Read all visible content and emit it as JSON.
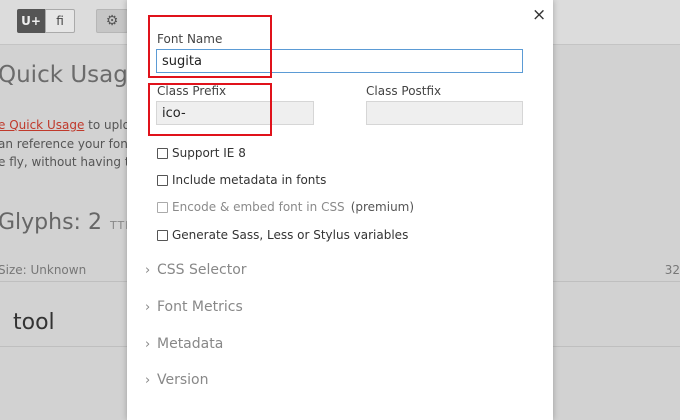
{
  "toolbar": {
    "uplus_label": "U+",
    "fi_label": "fi",
    "gear_glyph": "⚙"
  },
  "background": {
    "heading": "Quick Usage",
    "line1_link": "e Quick Usage",
    "line1_rest": " to uploa",
    "line2": "an reference your fonts",
    "line3": "e fly, without having to",
    "glyphs": "Glyphs: 2",
    "ttf": "TTF",
    "size": "Size: Unknown",
    "right_num": "32",
    "tool": "tool"
  },
  "modal": {
    "close_glyph": "×",
    "font_name_label": "Font Name",
    "font_name_value": "sugita",
    "class_prefix_label": "Class Prefix",
    "class_prefix_value": "ico-",
    "class_postfix_label": "Class Postfix",
    "class_postfix_value": "",
    "options": [
      {
        "label": "Support IE 8",
        "extra": ""
      },
      {
        "label": "Include metadata in fonts",
        "extra": ""
      },
      {
        "label": "Encode & embed font in CSS",
        "extra": "(premium)"
      },
      {
        "label": "Generate Sass, Less or Stylus variables",
        "extra": ""
      }
    ],
    "sections": [
      {
        "label": "CSS Selector"
      },
      {
        "label": "Font Metrics"
      },
      {
        "label": "Metadata"
      },
      {
        "label": "Version"
      }
    ],
    "chevron_glyph": "›"
  },
  "colors": {
    "highlight_box": "#e0121b",
    "focus_border": "#5b9bd5"
  }
}
